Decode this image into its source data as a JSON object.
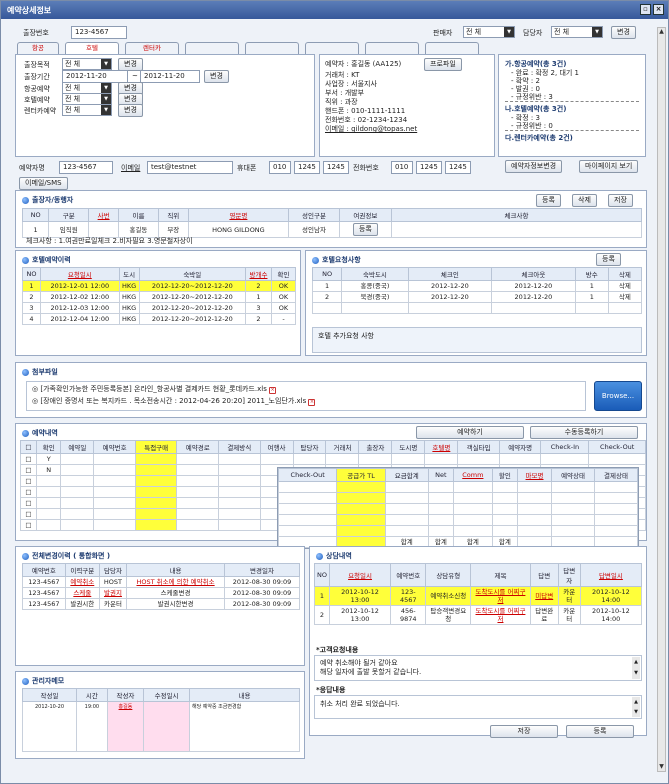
{
  "title": "예약상세정보",
  "top": {
    "order_label": "출장번호",
    "order_value": "123-4567",
    "seller_label": "판매자",
    "seller_value": "전  체",
    "agent_label": "담당자",
    "agent_value": "전  체",
    "change": "변경"
  },
  "tabs": [
    "항공",
    "호텔",
    "렌터카"
  ],
  "cond": {
    "purpose_label": "출장목적",
    "purpose_value": "전  체",
    "change": "변경",
    "period_label": "출장기간",
    "date_from": "2012-11-20",
    "tilde": "~",
    "date_to": "2012-11-20",
    "air_label": "항공예약",
    "air_value": "전  체",
    "hotel_label": "호텔예약",
    "hotel_value": "전  체",
    "car_label": "렌터카예약",
    "car_value": "전  체"
  },
  "profile": {
    "booker": "예약자 : 홍길동 (AA125)",
    "profile_btn": "프로파일",
    "company": "거래처 : KT",
    "site": "사업장 : 서울지사",
    "dept": "부서 : 개발부",
    "rank": "직위 : 과장",
    "mobile": "핸드폰 : 010-1111-1111",
    "phone": "전화번호 : 02-1234-1234",
    "email_text": "이메일 : gildong@topas.net"
  },
  "summary": {
    "air_head": "가.항공예약(총 3건)",
    "air_lines": [
      "- 완료 : 확정 2, 대기 1",
      "- 확약 : 2",
      "- 발권 : 0",
      "- 규정위반 : 3"
    ],
    "hotel_head": "나.호텔예약(총 3건)",
    "hotel_lines": [
      "- 확정 : 3",
      "- 규정위반 : 0"
    ],
    "car_head": "다.렌터카예약(총 2건)"
  },
  "contact": {
    "booker_no_label": "예약자명",
    "booker_no": "123-4567",
    "email_label": "이메일",
    "email": "test@testnet",
    "mobile_label": "휴대폰",
    "m1": "010",
    "m2": "1245",
    "m3": "1245",
    "tel_label": "전화번호",
    "t1": "010",
    "t2": "1245",
    "t3": "1245",
    "change_btn": "예약자정보변경",
    "mypage_btn": "마이페이지 보기",
    "email_sms_btn": "이메일/SMS"
  },
  "travelers": {
    "title": "출장자/동행자",
    "btns": [
      "등록",
      "삭제",
      "저장"
    ],
    "headers": [
      "NO",
      "구분",
      "사번",
      "이름",
      "직위",
      "영문명",
      "성인구분",
      "여권정보",
      "체크사항"
    ],
    "rows": [
      [
        "1",
        "임직원",
        "",
        "홍길동",
        "부장",
        "HONG GILDONG",
        "성인남자",
        "등록",
        ""
      ]
    ],
    "note": "체크사항 : 1.여권만료일체크   2.비자필요   3.영문철자상이"
  },
  "hotel_hist": {
    "title": "호텔예약이력",
    "headers": [
      "NO",
      "요청일시",
      "도시",
      "숙박일",
      "방개수",
      "확인"
    ],
    "rows": [
      [
        "1",
        "2012-12-01 12:00",
        "HKG",
        "2012-12-20~2012-12-20",
        "2",
        "OK"
      ],
      [
        "2",
        "2012-12-02 12:00",
        "HKG",
        "2012-12-20~2012-12-20",
        "1",
        "OK"
      ],
      [
        "3",
        "2012-12-03 12:00",
        "HKG",
        "2012-12-20~2012-12-20",
        "3",
        "OK"
      ],
      [
        "4",
        "2012-12-04 12:00",
        "HKG",
        "2012-12-20~2012-12-20",
        "2",
        "-"
      ]
    ]
  },
  "hotel_req": {
    "title": "호텔요청사항",
    "reg_btn": "등록",
    "headers": [
      "NO",
      "숙박도시",
      "체크인",
      "체크아웃",
      "방수",
      "삭제"
    ],
    "rows": [
      [
        "1",
        "홍콩(중국)",
        "2012-12-20",
        "2012-12-20",
        "1",
        "삭제"
      ],
      [
        "2",
        "북경(중국)",
        "2012-12-20",
        "2012-12-20",
        "1",
        "삭제"
      ]
    ],
    "extra_label": "호텔 추가요청 사항"
  },
  "attach": {
    "title": "첨부파일",
    "files": [
      "[가족확인가능한 주민등록등본] 온라인_항공사별 결제카드 현황_롯데카드.xls",
      "[장애인 증명서 또는 복지카드 . 목소전송시간 : 2012-04-26 20:20] 2011_노임단가.xls"
    ],
    "browse": "Browse..."
  },
  "booking": {
    "title": "예약내역",
    "btn1": "예약하기",
    "btn2": "수동등록하기",
    "headers": [
      "□",
      "확인",
      "예약일",
      "예약번호",
      "특접구매",
      "예약경로",
      "결제방식",
      "여행사",
      "탑당자",
      "거래처",
      "출장자",
      "도시명",
      "호텔명",
      "객실타입",
      "예약자명",
      "Check-In",
      "Check-Out"
    ],
    "rows": [
      [
        "□",
        "Y"
      ],
      [
        "□",
        "N"
      ],
      [
        "□",
        ""
      ],
      [
        "□",
        ""
      ],
      [
        "□",
        ""
      ],
      [
        "□",
        ""
      ],
      [
        "□",
        ""
      ]
    ],
    "sub_headers": [
      "Check-Out",
      "공급가 TL",
      "요금합계",
      "Net",
      "Comm",
      "할인",
      "마모명",
      "예약상태",
      "결제상태"
    ],
    "sum_label": "합계"
  },
  "changes": {
    "title": "전체변경이력 ( 통합화면 )",
    "headers": [
      "예약번호",
      "이력구분",
      "담당자",
      "내용",
      "변경일자"
    ],
    "rows": [
      [
        "123-4567",
        "예약취소",
        "HOST",
        "HOST 취소에 의한 예약취소",
        "2012-08-30 09:09"
      ],
      [
        "123-4567",
        "스케줄",
        "발권지",
        "스케줄변경",
        "2012-08-30 09:09"
      ],
      [
        "123-4567",
        "발권시한",
        "카운터",
        "발권시한변경",
        "2012-08-30 09:09"
      ]
    ]
  },
  "consult": {
    "title": "상담내역",
    "headers": [
      "NO",
      "요청일시",
      "예약번호",
      "상담유형",
      "제목",
      "답변",
      "답변자",
      "답변일시"
    ],
    "rows": [
      [
        "1",
        "2012-10-12 13:00",
        "123-4567",
        "예약취소신청",
        "도착도시를 어찌구 저",
        "미답변",
        "카운터",
        "2012-10-12 14:00"
      ],
      [
        "2",
        "2012-10-12 13:00",
        "456-9874",
        "탑승객변경요청",
        "도착도시를 어찌구 저",
        "답변완료",
        "카운터",
        "2012-10-12 14:00"
      ]
    ]
  },
  "memo": {
    "title": "관리자메모",
    "headers": [
      "작성일",
      "시간",
      "작성자",
      "수정일시",
      "내용"
    ],
    "row": [
      "2012-10-20",
      "19:00",
      "홍길동",
      "",
      "해당 예약중 조금변경함"
    ]
  },
  "cust_req": {
    "title": "*고객요청내용",
    "text1": "예약 취소해야 될거 같아요",
    "text2": "해당 일자에 출발 못할거 같습니다."
  },
  "reply": {
    "title": "*응답내용",
    "text": "취소 처리 완료 되었습니다."
  },
  "bottom": {
    "save": "저장",
    "register": "등록"
  }
}
